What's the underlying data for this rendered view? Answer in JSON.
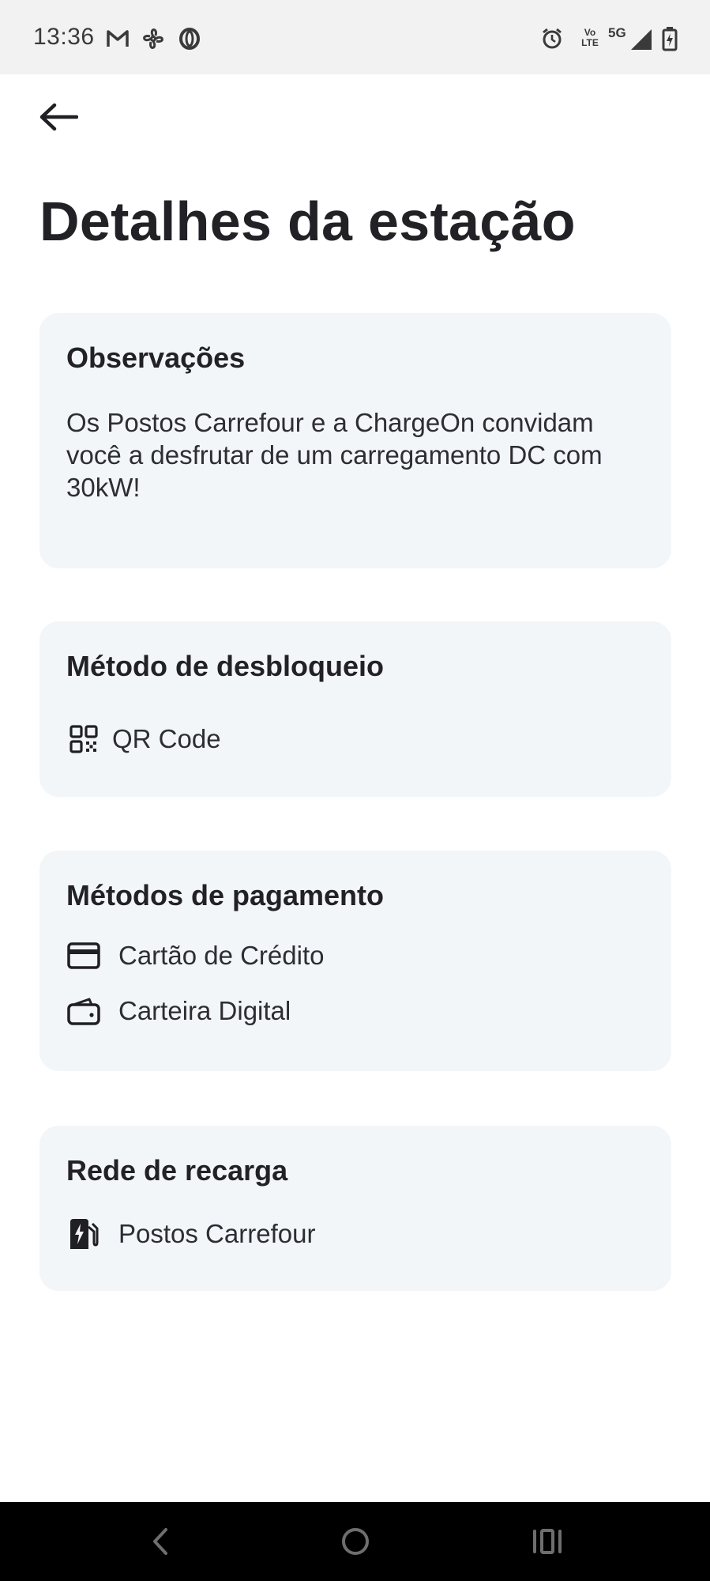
{
  "status_bar": {
    "time": "13:36",
    "left_icons": [
      "gmail-icon",
      "fan-icon",
      "opera-icon"
    ],
    "right_icons": [
      "alarm-icon",
      "volte-icon",
      "5g-icon",
      "signal-icon",
      "battery-charging-icon"
    ],
    "network_label": "5G",
    "volte_top": "Vo",
    "volte_bottom": "LTE"
  },
  "header": {
    "back_icon": "arrow-left-icon",
    "title": "Detalhes da estação"
  },
  "observations": {
    "title": "Observações",
    "text": "Os Postos Carrefour e a ChargeOn convidam você a desfrutar de um carregamento DC com 30kW!"
  },
  "unlock_method": {
    "title": "Método de desbloqueio",
    "items": [
      {
        "icon": "qr-code-icon",
        "label": "QR Code"
      }
    ]
  },
  "payment_methods": {
    "title": "Métodos de pagamento",
    "items": [
      {
        "icon": "credit-card-icon",
        "label": "Cartão de Crédito"
      },
      {
        "icon": "wallet-icon",
        "label": "Carteira Digital"
      }
    ]
  },
  "charging_network": {
    "title": "Rede de recarga",
    "items": [
      {
        "icon": "ev-station-icon",
        "label": "Postos Carrefour"
      }
    ]
  },
  "nav_bar": {
    "icons": [
      "back-nav-icon",
      "home-nav-icon",
      "recents-nav-icon"
    ]
  }
}
